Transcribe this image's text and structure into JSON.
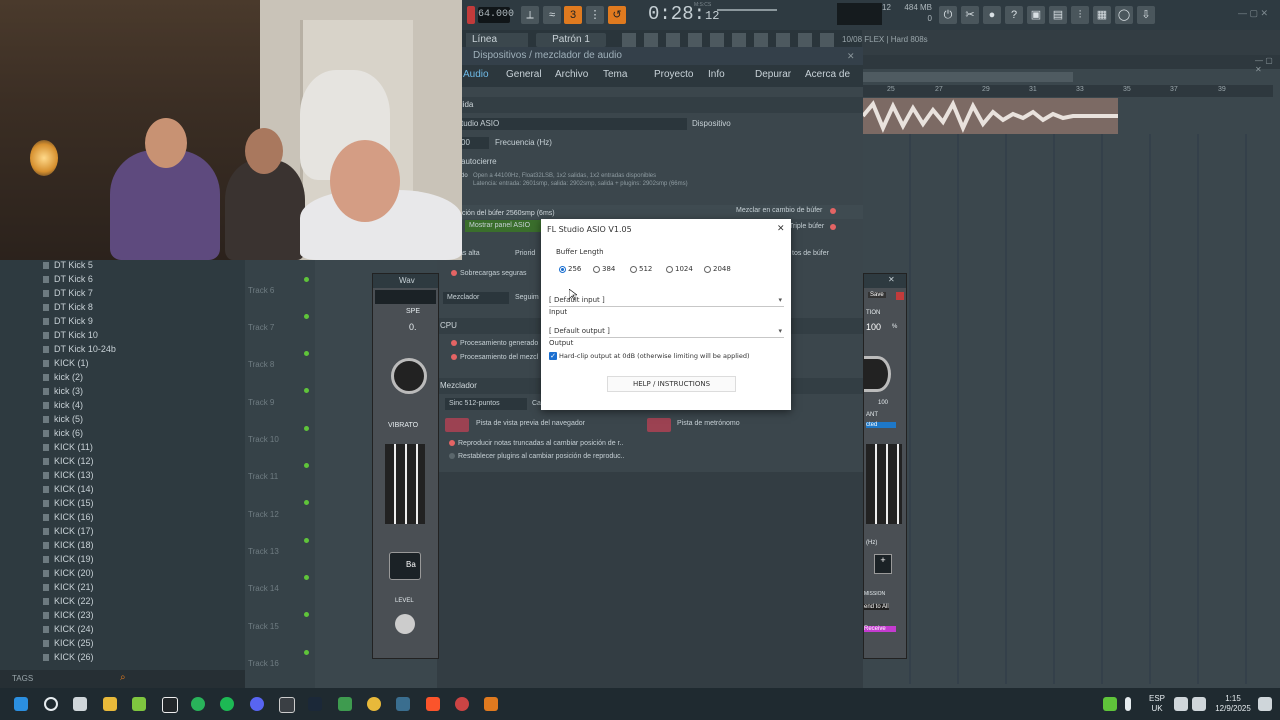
{
  "toolbar": {
    "bpm": "64.000",
    "time_main": "0:28",
    "time_sub": "12",
    "time_caption": "M:S:CS",
    "cpu_caption": "12",
    "mem_mb": "484 MB",
    "mem_sub": "0",
    "mode_label": "Línea",
    "pattern_label": "Patrón 1",
    "hint_text": "10/08 FLEX | Hard 808s"
  },
  "settings": {
    "window_title": "Dispositivos / mezclador de audio",
    "tabs": [
      "Audio",
      "General",
      "Archivo",
      "Tema",
      "Proyecto",
      "Info",
      "Depurar",
      "Acerca de"
    ],
    "io_header": "a / Salida",
    "device_value": "tudio ASIO",
    "device_label": "Dispositivo",
    "freq_value": "00",
    "freq_label": "Frecuencia (Hz)",
    "auto_close": "autocierre",
    "status_label": "do",
    "status_line1": "Open a 44100Hz, Float32LSB, 1x2 salidas, 1x2 entradas disponibles",
    "status_line2": "Latencia: entrada: 2601smp, salida: 2902smp, salida + plugins: 2902smp (66ms)",
    "buffer_label": "ción del búfer 2560smp (6ms)",
    "show_asio_panel": "Mostrar panel ASIO",
    "mix_on_buffer_change": "Mezclar en cambio de búfer",
    "triple_buffer": "Triple búfer",
    "alta": "ás alta",
    "priority": "Priorid",
    "buffer_tips": "tos de búfer",
    "safe_overloads": "Sobrecargas seguras",
    "mixer_label": "Mezclador",
    "mixer_follow": "Seguim",
    "cpu_header": "CPU",
    "proc_gen": "Procesamiento generado",
    "proc_mix": "Procesamiento del mezcl",
    "mixer_header": "Mezclador",
    "interp_value": "Sinc 512-puntos",
    "interp_extra": "Ca",
    "preview_track": "Pista de vista previa del navegador",
    "metronome_track": "Pista de metrónomo",
    "play_truncated": "Reproducir notas truncadas al cambiar posición de r..",
    "reset_plugins": "Restablecer plugins al cambiar posición de reproduc.."
  },
  "asio_dialog": {
    "title": "FL Studio ASIO V1.05",
    "close": "✕",
    "buffer_length_label": "Buffer Length",
    "buffer_options": [
      "256",
      "384",
      "512",
      "1024",
      "2048"
    ],
    "buffer_selected": "256",
    "input_value": "[ Default input ]",
    "input_label": "Input",
    "output_value": "[ Default output ]",
    "output_label": "Output",
    "hardclip_label": "Hard-clip output at 0dB (otherwise limiting will be applied)",
    "hardclip_checked": true,
    "help_button": "HELP / INSTRUCTIONS"
  },
  "browser": {
    "items": [
      "DT Kick 5",
      "DT Kick 6",
      "DT Kick 7",
      "DT Kick 8",
      "DT Kick 9",
      "DT Kick 10",
      "DT Kick 10-24b",
      "KICK (1)",
      "kick (2)",
      "kick (3)",
      "kick (4)",
      "kick (5)",
      "kick (6)",
      "KICK (11)",
      "KICK (12)",
      "KICK (13)",
      "KICK (14)",
      "KICK (15)",
      "KICK (16)",
      "KICK (17)",
      "KICK (18)",
      "KICK (19)",
      "KICK (20)",
      "KICK (21)",
      "KICK (22)",
      "KICK (23)",
      "KICK (24)",
      "KICK (25)",
      "KICK (26)"
    ],
    "tags_label": "TAGS"
  },
  "playlist": {
    "tracks": [
      "Track 6",
      "Track 7",
      "Track 8",
      "Track 9",
      "Track 10",
      "Track 11",
      "Track 12",
      "Track 13",
      "Track 14",
      "Track 15",
      "Track 16"
    ],
    "ruler_numbers": [
      "25",
      "27",
      "29",
      "31",
      "33",
      "35",
      "37",
      "39"
    ]
  },
  "plugin_left": {
    "title": "Wav",
    "label_spe": "SPE",
    "value": "0.",
    "vibrato": "VIBRATO",
    "level": "LEVEL",
    "ba": "Ba"
  },
  "plugin_right": {
    "save": "Save",
    "tion": "TION",
    "value": "100",
    "pct": "%",
    "ant": "ANT",
    "cted": "cted",
    "knob_val": "100",
    "hz": "(Hz)",
    "send_all": "end to All",
    "receive": "Receive",
    "mission": "MISSION"
  },
  "taskbar": {
    "lang_line1": "ESP",
    "lang_line2": "UK",
    "clock_time": "1:15",
    "clock_date": "12/9/2025"
  }
}
